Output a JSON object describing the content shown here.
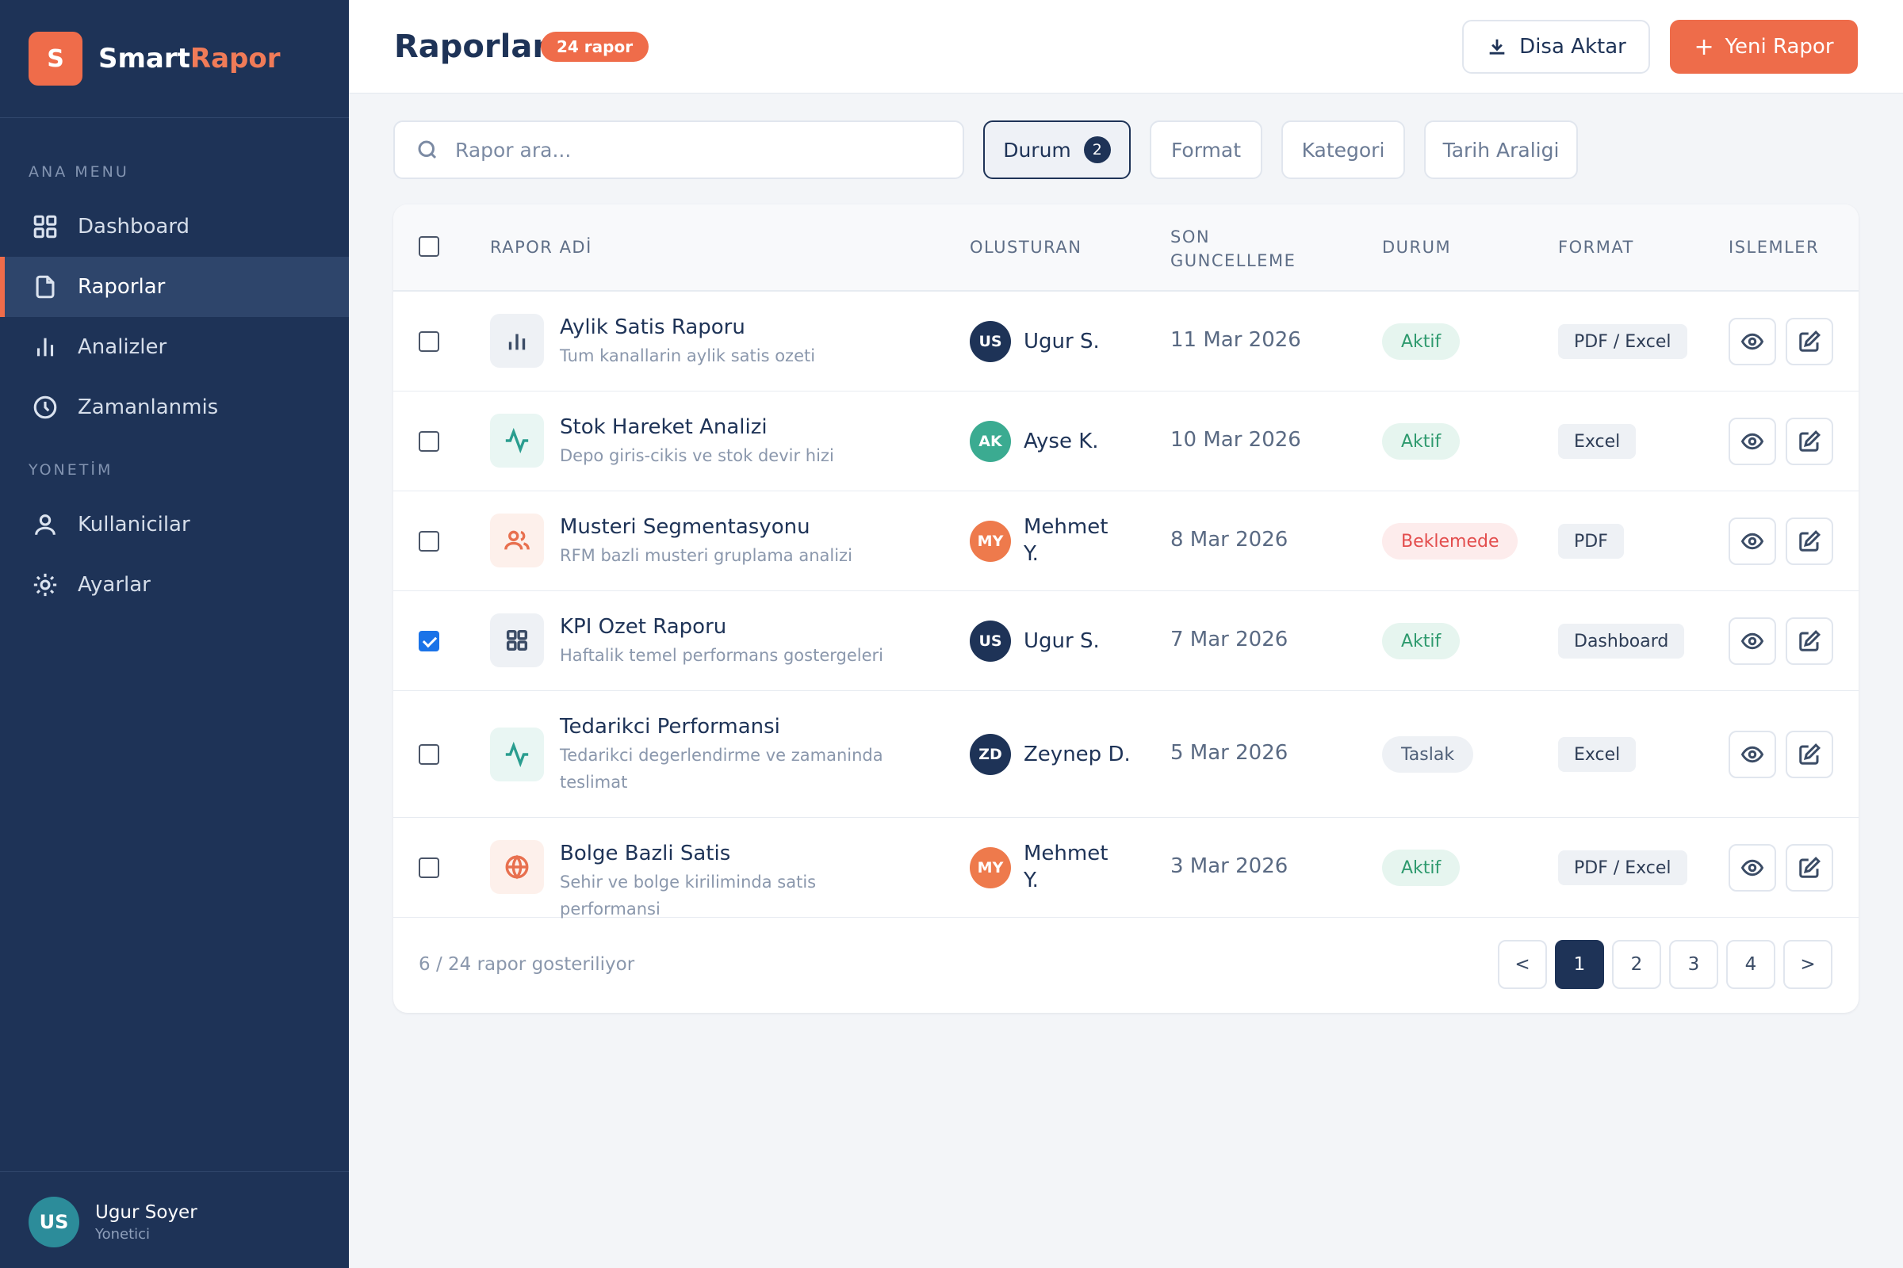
{
  "brand": {
    "logo_letter": "S",
    "name_part1": "Smart",
    "name_part2": "Rapor"
  },
  "sidebar": {
    "section_main": "ANA MENU",
    "section_admin": "YONETİM",
    "items": [
      {
        "label": "Dashboard",
        "icon": "grid-icon"
      },
      {
        "label": "Raporlar",
        "icon": "document-icon"
      },
      {
        "label": "Analizler",
        "icon": "bar-chart-icon"
      },
      {
        "label": "Zamanlanmis",
        "icon": "clock-icon"
      },
      {
        "label": "Kullanicilar",
        "icon": "user-icon"
      },
      {
        "label": "Ayarlar",
        "icon": "sun-gear-icon"
      }
    ],
    "active_item": "Raporlar",
    "user": {
      "initials": "US",
      "name": "Ugur Soyer",
      "role": "Yonetici"
    }
  },
  "header": {
    "title": "Raporlar",
    "count_badge": "24 rapor",
    "export_label": "Disa Aktar",
    "new_label": "Yeni Rapor"
  },
  "filters": {
    "search_placeholder": "Rapor ara...",
    "chips": [
      {
        "label": "Durum",
        "count": "2",
        "active": true
      },
      {
        "label": "Format"
      },
      {
        "label": "Kategori"
      },
      {
        "label": "Tarih Araligi"
      }
    ]
  },
  "table": {
    "columns": [
      "RAPOR ADİ",
      "OLUSTURAN",
      "SON GUNCELLEME",
      "DURUM",
      "FORMAT",
      "ISLEMLER"
    ],
    "column_son": "SON",
    "column_guncelleme": "GUNCELLEME",
    "rows": [
      {
        "checked": false,
        "icon": "bar-chart-icon",
        "name": "Aylik Satis Raporu",
        "desc": "Tum kanallarin aylik satis ozeti",
        "initials": "US",
        "creator": "Ugur S.",
        "date": "11 Mar 2026",
        "status": "Aktif",
        "format": "PDF / Excel"
      },
      {
        "checked": false,
        "icon": "activity-icon",
        "name": "Stok Hareket Analizi",
        "desc": "Depo giris-cikis ve stok devir hizi",
        "initials": "AK",
        "creator": "Ayse K.",
        "date": "10 Mar 2026",
        "status": "Aktif",
        "format": "Excel"
      },
      {
        "checked": false,
        "icon": "users-icon",
        "name": "Musteri Segmentasyonu",
        "desc": "RFM bazli musteri gruplama analizi",
        "initials": "MY",
        "creator": "Mehmet Y.",
        "date": "8 Mar 2026",
        "status": "Beklemede",
        "format": "PDF"
      },
      {
        "checked": true,
        "icon": "grid-icon",
        "name": "KPI Ozet Raporu",
        "desc": "Haftalik temel performans gostergeleri",
        "initials": "US",
        "creator": "Ugur S.",
        "date": "7 Mar 2026",
        "status": "Aktif",
        "format": "Dashboard"
      },
      {
        "checked": false,
        "icon": "activity-icon",
        "name": "Tedarikci Performansi",
        "desc": "Tedarikci degerlendirme ve zamaninda teslimat",
        "initials": "ZD",
        "creator": "Zeynep D.",
        "date": "5 Mar 2026",
        "status": "Taslak",
        "format": "Excel"
      },
      {
        "checked": false,
        "icon": "globe-icon",
        "name": "Bolge Bazli Satis",
        "desc": "Sehir ve bolge kiriliminda satis performansi",
        "initials": "MY",
        "creator": "Mehmet Y.",
        "date": "3 Mar 2026",
        "status": "Aktif",
        "format": "PDF / Excel"
      }
    ],
    "action_icons": [
      "eye-icon",
      "edit-icon"
    ]
  },
  "pagination": {
    "summary": "6 / 24 rapor gosteriliyor",
    "prev": "<",
    "pages": [
      "1",
      "2",
      "3",
      "4"
    ],
    "current": "1",
    "next": ">"
  },
  "colors": {
    "sidebar_bg": "#1e3357",
    "accent": "#ef6c4a",
    "status_active": "#2e9a6e",
    "status_pending": "#e34d4d",
    "status_draft": "#4f5f78"
  }
}
